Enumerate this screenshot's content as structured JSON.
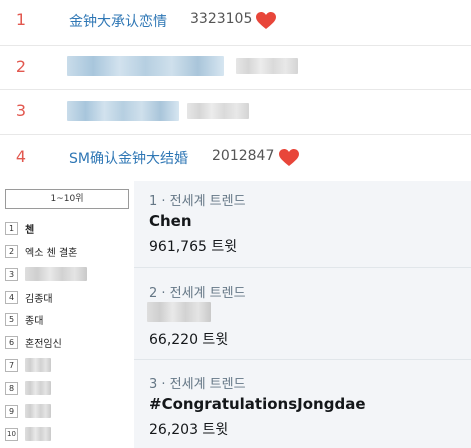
{
  "hot_search": [
    {
      "rank": "1",
      "title": "金钟大承认恋情",
      "count": "3323105",
      "icon": "heart-icon",
      "blurred": false
    },
    {
      "rank": "2",
      "title": "",
      "count": "",
      "blurred": true
    },
    {
      "rank": "3",
      "title": "",
      "count": "",
      "blurred": true
    },
    {
      "rank": "4",
      "title": "SM确认金钟大结婚",
      "count": "2012847",
      "icon": "heart-icon",
      "blurred": false
    }
  ],
  "trending_korea": {
    "range_label": "1~10위",
    "items": [
      {
        "num": "1",
        "label": "첸",
        "bold": true,
        "blurred": false
      },
      {
        "num": "2",
        "label": "엑소 첸 결혼",
        "bold": false,
        "blurred": false
      },
      {
        "num": "3",
        "label": "",
        "blurred": true
      },
      {
        "num": "4",
        "label": "김종대",
        "bold": false,
        "blurred": false
      },
      {
        "num": "5",
        "label": "종대",
        "bold": false,
        "blurred": false
      },
      {
        "num": "6",
        "label": "혼전임신",
        "bold": false,
        "blurred": false
      },
      {
        "num": "7",
        "label": "",
        "blurred": true
      },
      {
        "num": "8",
        "label": "",
        "blurred": true
      },
      {
        "num": "9",
        "label": "",
        "blurred": true
      },
      {
        "num": "10",
        "label": "",
        "blurred": true
      }
    ]
  },
  "worldwide_trends": [
    {
      "meta": "1 · 전세계 트렌드",
      "name": "Chen",
      "tweets": "961,765 트윗",
      "blurred": false
    },
    {
      "meta": "2 · 전세계 트렌드",
      "name": "",
      "tweets": "66,220 트윗",
      "blurred": true
    },
    {
      "meta": "3 · 전세계 트렌드",
      "name": "#CongratulationsJongdae",
      "tweets": "26,203 트윗",
      "blurred": false
    }
  ],
  "colors": {
    "rank_red": "#e2584f",
    "hot_title_blue": "#2f77b5",
    "heart_red": "#e8463a",
    "trend_meta_gray": "#657786",
    "panel_bg": "#f3f5f8"
  }
}
